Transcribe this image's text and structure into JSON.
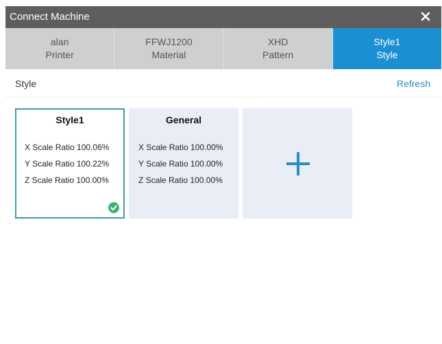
{
  "window": {
    "title": "Connect Machine"
  },
  "tabs": [
    {
      "line1": "alan",
      "line2": "Printer",
      "active": false
    },
    {
      "line1": "FFWJ1200",
      "line2": "Material",
      "active": false
    },
    {
      "line1": "XHD",
      "line2": "Pattern",
      "active": false
    },
    {
      "line1": "Style1",
      "line2": "Style",
      "active": true
    }
  ],
  "section": {
    "label": "Style",
    "refresh_label": "Refresh"
  },
  "cards": [
    {
      "title": "Style1",
      "selected": true,
      "metrics": [
        "X Scale Ratio  100.06%",
        "Y Scale Ratio  100.22%",
        "Z Scale Ratio  100.00%"
      ]
    },
    {
      "title": "General",
      "selected": false,
      "metrics": [
        "X Scale Ratio  100.00%",
        "Y Scale Ratio  100.00%",
        "Z Scale Ratio  100.00%"
      ]
    }
  ],
  "add_card": {
    "icon": "plus-icon"
  },
  "colors": {
    "titlebar": "#5e5e5e",
    "tab_inactive": "#cfcfcf",
    "tab_active": "#1a8fd4",
    "accent_link": "#2b8cc4",
    "selected_border": "#3a9dab",
    "check_green": "#3cb46e",
    "card_bg": "#e9eef6"
  }
}
